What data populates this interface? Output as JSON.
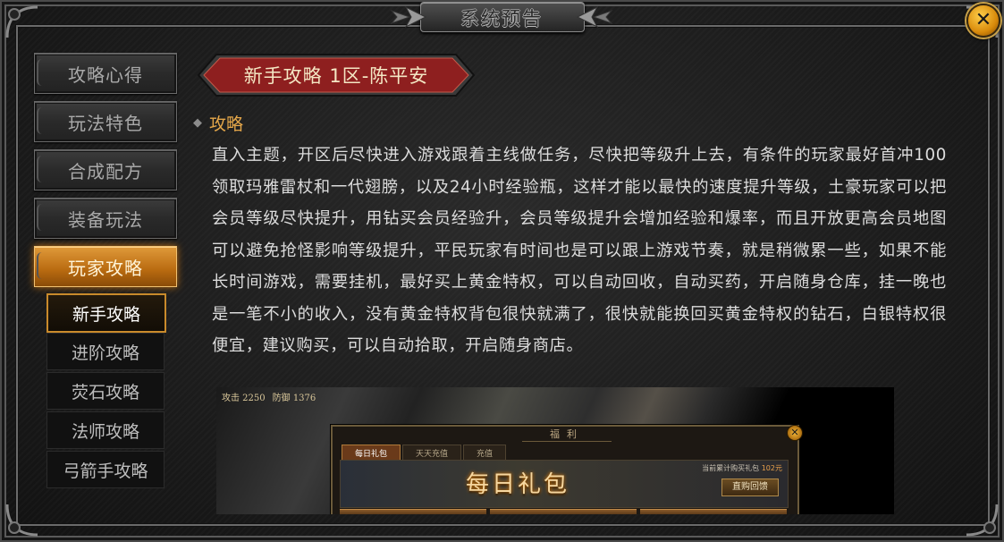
{
  "window": {
    "title": "系统预告",
    "close_label": "✕"
  },
  "menu": {
    "items": [
      {
        "label": "攻略心得",
        "active": false
      },
      {
        "label": "玩法特色",
        "active": false
      },
      {
        "label": "合成配方",
        "active": false
      },
      {
        "label": "装备玩法",
        "active": false
      },
      {
        "label": "玩家攻略",
        "active": true
      }
    ],
    "sub_items": [
      {
        "label": "新手攻略",
        "active": true
      },
      {
        "label": "进阶攻略",
        "active": false
      },
      {
        "label": "荧石攻略",
        "active": false
      },
      {
        "label": "法师攻略",
        "active": false
      },
      {
        "label": "弓箭手攻略",
        "active": false
      }
    ]
  },
  "article": {
    "header": "新手攻略 1区-陈平安",
    "section_title": "攻略",
    "body": "直入主题，开区后尽快进入游戏跟着主线做任务，尽快把等级升上去，有条件的玩家最好首冲100领取玛雅雷杖和一代翅膀，以及24小时经验瓶，这样才能以最快的速度提升等级，土豪玩家可以把会员等级尽快提升，用钻买会员经验升，会员等级提升会增加经验和爆率，而且开放更高会员地图可以避免抢怪影响等级提升，平民玩家有时间也是可以跟上游戏节奏，就是稍微累一些，如果不能长时间游戏，需要挂机，最好买上黄金特权，可以自动回收，自动买药，开启随身仓库，挂一晚也是一笔不小的收入，没有黄金特权背包很快就满了，很快就能换回买黄金特权的钻石，白银特权很便宜，建议购买，可以自动拾取，开启随身商店。"
  },
  "screenshot": {
    "stat_attack": "攻击 2250",
    "stat_defense": "防御 1376",
    "dialog_title": "福利",
    "dialog_close": "✕",
    "tabs": [
      "每日礼包",
      "天天充值",
      "充值"
    ],
    "banner_title": "每日礼包",
    "accum_label": "当前累计购买礼包",
    "accum_value": "102元",
    "buy_label": "直购回馈"
  },
  "colors": {
    "accent": "#e6a84a",
    "active_menu": "#c57a1a",
    "ribbon": "#8e1f1f"
  }
}
